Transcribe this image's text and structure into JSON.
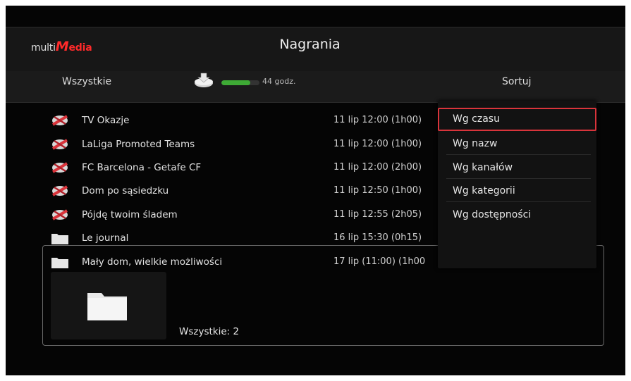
{
  "header": {
    "logo_prefix": "multi",
    "logo_m": "M",
    "logo_rest": "edia",
    "title": "Nagrania"
  },
  "toolbar": {
    "filter_label": "Wszystkie",
    "storage_icon": "disk-icon",
    "storage_fraction": 0.75,
    "storage_text": "44 godz.",
    "sort_label": "Sortuj"
  },
  "recordings": [
    {
      "title": "TV Okazje",
      "time": "11 lip 12:00 (1h00)",
      "icon": "recording-icon"
    },
    {
      "title": "LaLiga Promoted Teams",
      "time": "11 lip 12:00 (1h00)",
      "icon": "recording-icon"
    },
    {
      "title": "FC Barcelona - Getafe CF",
      "time": "11 lip 12:00 (2h00)",
      "icon": "recording-icon"
    },
    {
      "title": "Dom po sąsiedzku",
      "time": "11 lip 12:50 (1h00)",
      "icon": "recording-icon"
    },
    {
      "title": "Pójdę twoim śladem",
      "time": "11 lip 12:55 (2h05)",
      "icon": "recording-icon"
    },
    {
      "title": "Le journal",
      "time": "16 lip 15:30 (0h15)",
      "icon": "folder-icon"
    },
    {
      "title": "Mały dom, wielkie możliwości",
      "time": "17 lip (11:00) (1h00",
      "icon": "folder-icon"
    }
  ],
  "selected": {
    "count_label": "Wszystkie: 2"
  },
  "sort_menu": {
    "options": [
      "Wg czasu",
      "Wg nazw",
      "Wg kanałów",
      "Wg kategorii",
      "Wg dostępności"
    ],
    "selected_index": 0
  },
  "colors": {
    "accent": "#d9343b",
    "storage": "#3eaa35",
    "background": "#050505"
  }
}
